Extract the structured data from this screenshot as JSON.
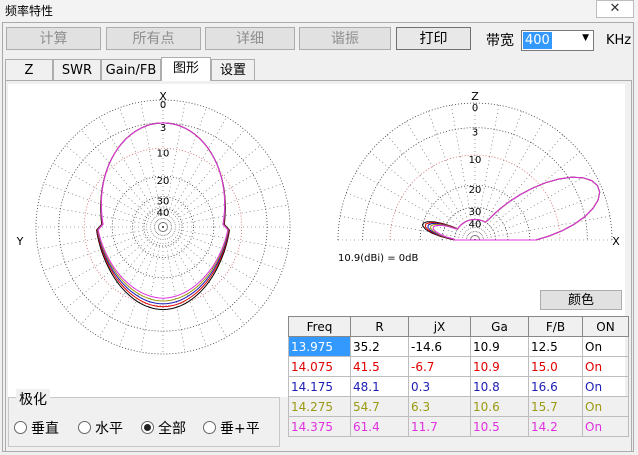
{
  "window": {
    "title": "频率特性",
    "close_icon": "✕"
  },
  "toolbar": {
    "buttons": [
      {
        "label": "计算"
      },
      {
        "label": "所有点"
      },
      {
        "label": "详细"
      },
      {
        "label": "谐振"
      },
      {
        "label": "打印"
      }
    ],
    "bandwidth_label": "带宽",
    "bandwidth_value": "400",
    "bandwidth_unit": "KHz"
  },
  "tabs": [
    {
      "label": "Z"
    },
    {
      "label": "SWR"
    },
    {
      "label": "Gain/FB"
    },
    {
      "label": "图形"
    },
    {
      "label": "设置"
    }
  ],
  "plots": {
    "left_top_label": "X",
    "left_side_label": "Y",
    "right_top_label": "Z",
    "right_side_label": "X",
    "ring_labels": [
      "0",
      "3",
      "10",
      "20",
      "30",
      "40"
    ],
    "scale_note": "10.9(dBi) = 0dB"
  },
  "color_button": "颜色",
  "table": {
    "columns": [
      "Freq",
      "R",
      "jX",
      "Ga",
      "F/B",
      "ON"
    ],
    "rows": [
      {
        "freq": "13.975",
        "r": "35.2",
        "jx": "-14.6",
        "ga": "10.9",
        "fb": "12.5",
        "on": "On",
        "color": "#000000"
      },
      {
        "freq": "14.075",
        "r": "41.5",
        "jx": "-6.7",
        "ga": "10.9",
        "fb": "15.0",
        "on": "On",
        "color": "#e00000"
      },
      {
        "freq": "14.175",
        "r": "48.1",
        "jx": "0.3",
        "ga": "10.8",
        "fb": "16.6",
        "on": "On",
        "color": "#1c1cb4"
      },
      {
        "freq": "14.275",
        "r": "54.7",
        "jx": "6.3",
        "ga": "10.6",
        "fb": "15.7",
        "on": "On",
        "color": "#9a9a10"
      },
      {
        "freq": "14.375",
        "r": "61.4",
        "jx": "11.7",
        "ga": "10.5",
        "fb": "14.2",
        "on": "On",
        "color": "#e030e0"
      }
    ]
  },
  "polarization": {
    "title": "极化",
    "options": [
      {
        "label": "垂直",
        "checked": false
      },
      {
        "label": "水平",
        "checked": false
      },
      {
        "label": "全部",
        "checked": true
      },
      {
        "label": "垂+平",
        "checked": false
      }
    ]
  }
}
